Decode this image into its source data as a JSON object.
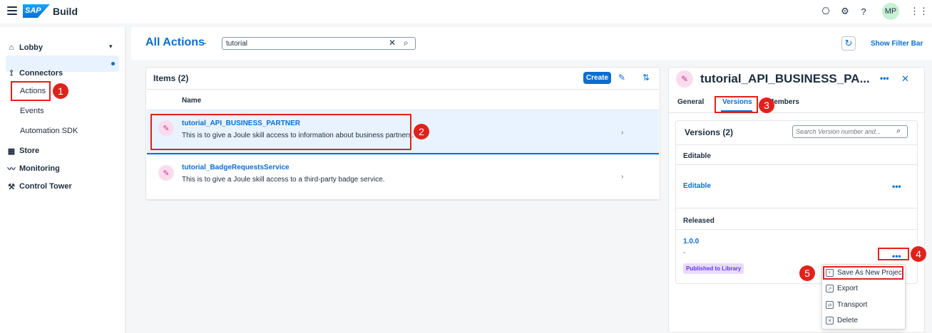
{
  "shell": {
    "brand_logo": "SAP",
    "brand_name": "Build",
    "avatar_initials": "MP",
    "icons": [
      "menu-icon",
      "bot-icon",
      "notification-icon",
      "help-icon",
      "grid-icon"
    ]
  },
  "sidebar": {
    "lobby": "Lobby",
    "connectors": "Connectors",
    "actions": "Actions",
    "events": "Events",
    "automation_sdk": "Automation SDK",
    "store": "Store",
    "monitoring": "Monitoring",
    "control_tower": "Control Tower"
  },
  "header": {
    "title": "All Actions",
    "search_value": "tutorial",
    "show_filter_bar": "Show Filter Bar"
  },
  "items": {
    "heading": "Items (2)",
    "create_label": "Create",
    "column_name": "Name",
    "rows": [
      {
        "title": "tutorial_API_BUSINESS_PARTNER",
        "desc": "This is to give a Joule skill access to information about business partners."
      },
      {
        "title": "tutorial_BadgeRequestsService",
        "desc": "This is to give a Joule skill access to a third-party badge service."
      }
    ]
  },
  "detail": {
    "title": "tutorial_API_BUSINESS_PA...",
    "tabs": [
      "General",
      "Versions",
      "Members"
    ],
    "versions_heading": "Versions (2)",
    "search_placeholder": "Search Version number and...",
    "editable_section": "Editable",
    "editable_link": "Editable",
    "released_section": "Released",
    "version": "1.0.0",
    "version_desc": "-",
    "published_badge": "Published to Library"
  },
  "menu": {
    "items": [
      "Save As New Project",
      "Export",
      "Transport",
      "Delete"
    ]
  },
  "annotations": [
    "1",
    "2",
    "3",
    "4",
    "5"
  ],
  "colors": {
    "accent": "#0a6ed1",
    "annotation": "#e0221c",
    "selected_row": "#e8f3ff"
  }
}
